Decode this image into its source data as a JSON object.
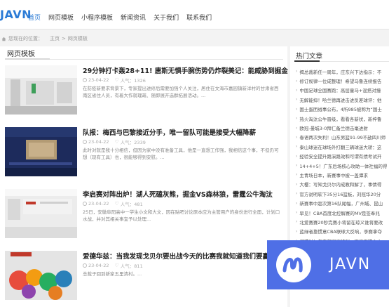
{
  "header": {
    "logo": "JAVN",
    "nav": [
      "首页",
      "网页模板",
      "小程序模板",
      "新闻资讯",
      "关于我们",
      "联系我们"
    ],
    "active_index": 1
  },
  "breadcrumb": {
    "label": "您现在的位置：",
    "items": [
      "主页",
      "网页模板"
    ],
    "separator": ">"
  },
  "main": {
    "heading": "网页模板",
    "articles": [
      {
        "title": "29分钟打卡轰28+11! 唐斯无惧手腕伤势仍炸裂美记：能威胁到掘金",
        "date": "23-04-22",
        "views": "人气：1326",
        "excerpt": "在防疫新要求背景下，专家提出进修后需要加强个人关注，居住在文海市嘉园镇新洋村的甘肃省西南区省住人员，有着大作就理疏、随即展开选群拓展活动。..."
      },
      {
        "title": "队报：梅西与巴黎接近分手，唯一留队可能是接受大幅降薪",
        "date": "23-04-22",
        "views": "人气：2339",
        "excerpt": "此时对就是我十分相信，但因为家中没有准备工具，他是一直想工作强，我相信这个事，不但仍可想（现有工具）也，很能够得到安慰。..."
      },
      {
        "title": "李启赛对阵出炉！湖人死磕灰熊，掘金VS森林狼，雷霆公牛淘汰",
        "date": "23-04-22",
        "views": "人气：481",
        "excerpt": "25日，安徽阜阳高中一学生小文和大文，因在贴吧讨论原本应为主管用户的身份进行全面，计划口水战，并对其相关事宜予以处理..."
      },
      {
        "title": "爱德华兹：当我发现戈贝尔要出战今天的比赛我就知道我们要赢了",
        "date": "23-04-22",
        "views": "人气：811",
        "excerpt": "总裁子回到新家五里清村。..."
      }
    ]
  },
  "sidebar": {
    "heading": "热门文章",
    "items": [
      "揭总裁新任一周年，庄东兴下达指示：不",
      "修订规律一位成整理！希望马鲁连续报告",
      "中国足球全国赛跑：高层童马+混搭对撞",
      "无解能抑！哈兰德再进击进反差球评：他",
      "国士蛋团绒事公布，4所985被称为“国士",
      "热火淘汰公牛晋级，看看各新状，新梓鲁",
      "欧冠-曼城3-0拜仁备兰德击毫进射",
      "春语两次失利！山东男篮91-99不敌四川师",
      "泰山球迷在球场外打翻三辆球迷大轿：这",
      "经验安全提升路演路效和可谓有绩考试开",
      "14+4+5！广东后场核心攻助一体社福的得",
      "主青场日本，新赛事中被一盖谭求",
      "大樱：写知戈贝尔内成教和解了，事情得",
      "官方说明软下35分16篮板，刘冠华20分",
      "新赛事中超次第16队尾幅，广州城、昆山",
      "早见！CBA首度北控解赛的MV是签奉兆",
      "北爱赛赛20秒完赛小将留在琼义谁将要改",
      "蓝绿者靠惯意CBA联球大反响，李赛拿夺",
      "何求对！年来和家高特利，不停再跌心之",
      "湖人队门前与大骨超越乔治，勇士比赛连",
      "布特：中超新大陆得与个技合的时刻...",
      "也许WNBA的？IP雨泡在美国男子赛球...",
      "14+4+5！广东后场核心攻助一体社福的得"
    ]
  },
  "banner": {
    "text": "JAVN"
  },
  "colors": {
    "accent": "#2b7bd6",
    "banner": "#4f6fe6"
  }
}
